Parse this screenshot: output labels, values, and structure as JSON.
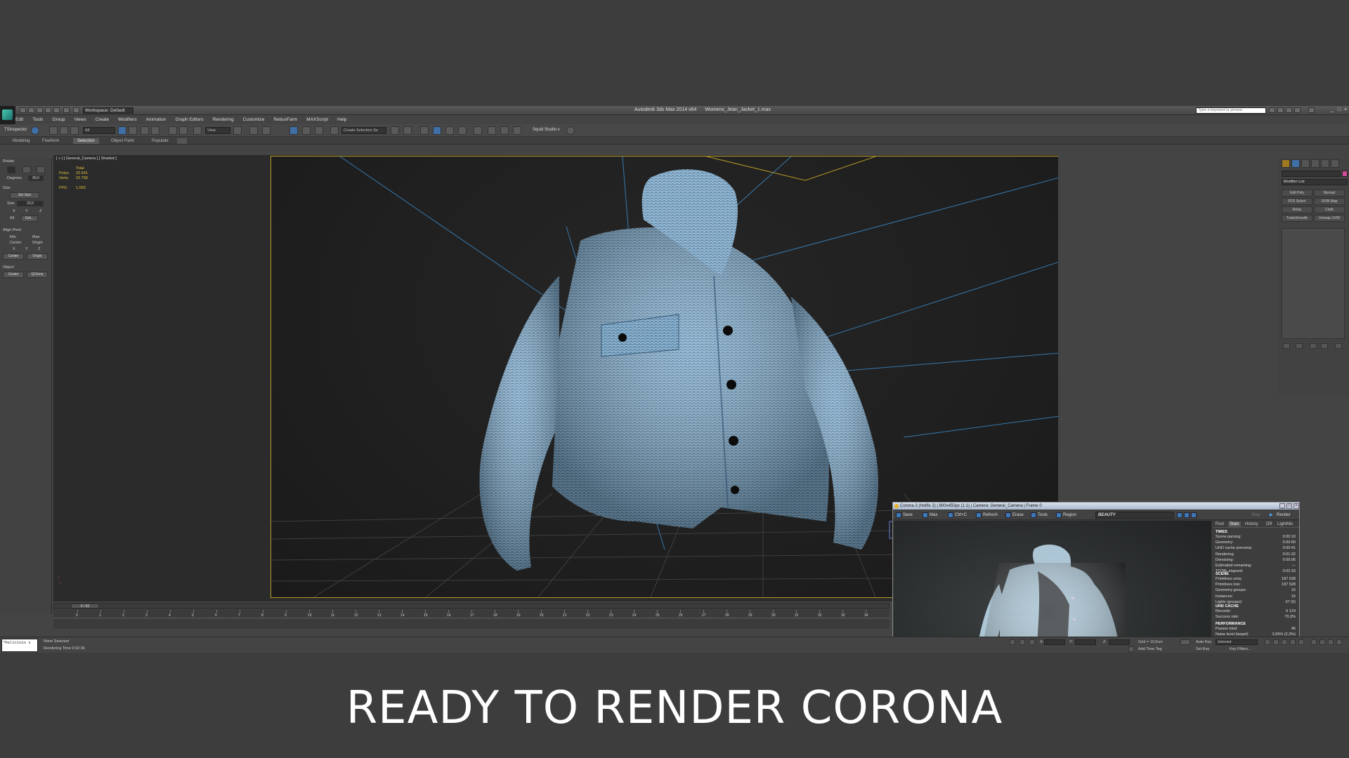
{
  "titlebar": {
    "workspace": "Workspace: Default",
    "app_name": "Autodesk 3ds Max  2014 x64",
    "file_name": "Womens_Jean_Jacket_1.max",
    "search_placeholder": "Type a keyword or phrase"
  },
  "menu": [
    "Edit",
    "Tools",
    "Group",
    "Views",
    "Create",
    "Modifiers",
    "Animation",
    "Graph Editors",
    "Rendering",
    "Customize",
    "RebusFarm",
    "MAXScript",
    "Help"
  ],
  "toolbar": {
    "left_label": "TSInspector",
    "filter_value": "All",
    "view_value": "View",
    "selection_set_placeholder": "Create Selection Se",
    "squid_label": "Squid Studio v"
  },
  "ribbon_tabs": [
    "Modeling",
    "Freeform",
    "Selection",
    "Object Paint",
    "Populate"
  ],
  "ribbon_active": "Selection",
  "leftpanel": {
    "rotate_title": "Rotate",
    "degrees_label": "Degrees",
    "degrees_value": "90,0",
    "size_title": "Size",
    "set_size": "Set Size",
    "size_label": "Size",
    "size_value": "20,0",
    "x": "X",
    "y": "Y",
    "z": "Z",
    "all": "All",
    "get": "Get...",
    "align_title": "Align Pivot",
    "min": "Min",
    "max": "Max",
    "center": "Center",
    "origin": "Origin",
    "object_title": "Object",
    "obj_center": "Center",
    "qclone": "QClone"
  },
  "viewport": {
    "label": "[ + ] [ General_Camera ] [ Shaded ]",
    "stats_header": "Total",
    "polys_label": "Polys:",
    "polys_value": "23 641",
    "verts_label": "Verts:",
    "verts_value": "23 758",
    "fps_label": "FPS:",
    "fps_value": "1,093"
  },
  "vfb": {
    "title": "Corona 3 (Hotfix 2) | 800x450px (1:1) | Camera: General_Camera | Frame 0",
    "toolbar": [
      "Save",
      "Max",
      "Ctrl+C",
      "Refresh",
      "Erase",
      "Tools",
      "Region"
    ],
    "pass": "BEAUTY",
    "render_label": "Render",
    "stop_label": "Stop",
    "tabs": [
      "Post",
      "Stats",
      "History",
      "DR",
      "LightMix"
    ],
    "active_tab": "Stats",
    "sections": {
      "times": "TIMES",
      "scene": "SCENE",
      "uhd": "UHD CACHE",
      "performance": "PERFORMANCE"
    },
    "times": [
      {
        "k": "Scene parsing:",
        "v": "0:00:10"
      },
      {
        "k": "Geometry:",
        "v": "0:00:00"
      },
      {
        "k": "UHD cache precomp:",
        "v": "0:00:41"
      },
      {
        "k": "Rendering:",
        "v": "0:01:32"
      },
      {
        "k": "Denoising:",
        "v": "0:00:06"
      },
      {
        "k": "Estimated remaining:",
        "v": "---"
      },
      {
        "k": "TOTAL elapsed:",
        "v": "0:02:33"
      }
    ],
    "scene": [
      {
        "k": "Primitives uniq.:",
        "v": "187 528"
      },
      {
        "k": "Primitives inst.:",
        "v": "187 528"
      },
      {
        "k": "Geometry groups:",
        "v": "16"
      },
      {
        "k": "Instances:",
        "v": "16"
      },
      {
        "k": "Lights (groups):",
        "v": "67 (6)"
      }
    ],
    "uhd": [
      {
        "k": "Records:",
        "v": "6 124"
      },
      {
        "k": "Success rate:",
        "v": "70,3%"
      }
    ],
    "performance": [
      {
        "k": "Passes total:",
        "v": "46"
      },
      {
        "k": "Noise level (target):",
        "v": "3,65% (2,3%)"
      },
      {
        "k": "Rays/s total:",
        "v": "2 909 080"
      },
      {
        "k": "Rays/s actual:",
        "v": "0"
      },
      {
        "k": "Samples/s actual:",
        "v": "0"
      },
      {
        "k": "Rays/sample:",
        "v": "23,2"
      },
      {
        "k": "VFB refresh time:",
        "v": "68ms"
      },
      {
        "k": "Preview denoiser time:",
        "v": "---"
      }
    ]
  },
  "cmdpanel": {
    "modifier_list": "Modifier List",
    "buttons": [
      "Edit Poly",
      "Normal",
      "FFD Select",
      "UVW Map",
      "Relax",
      "Cloth",
      "TurboSmooth",
      "Unwrap UVW"
    ]
  },
  "timeline": {
    "frame_range": "0 / 50",
    "ticks": [
      "0",
      "1",
      "2",
      "3",
      "4",
      "5",
      "6",
      "7",
      "8",
      "9",
      "10",
      "11",
      "12",
      "13",
      "14",
      "15",
      "16",
      "17",
      "18",
      "19",
      "20",
      "21",
      "22",
      "23",
      "24",
      "25",
      "26",
      "27",
      "28",
      "29",
      "30",
      "31",
      "32",
      "33",
      "34"
    ]
  },
  "status": {
    "maxscript": "\"Malicious s",
    "selection": "None Selected",
    "render_time": "Rendering Time  0:02:36",
    "x_label": "X:",
    "y_label": "Y:",
    "z_label": "Z:",
    "grid": "Grid = 10,0cm",
    "add_time_tag": "Add Time Tag",
    "auto_key": "Auto Key",
    "selected": "Selected",
    "set_key": "Set Key",
    "key_filters": "Key Filters..."
  },
  "caption": "READY TO RENDER  CORONA",
  "colors": {
    "background": "#3d3d3d",
    "ui_panel": "#444444",
    "viewport": "#2b2b2b",
    "safe_frame": "#b59a28",
    "stats_text": "#e0c23a",
    "denim": "#6f9bbd",
    "vfb_title": "#c8d4e4"
  }
}
